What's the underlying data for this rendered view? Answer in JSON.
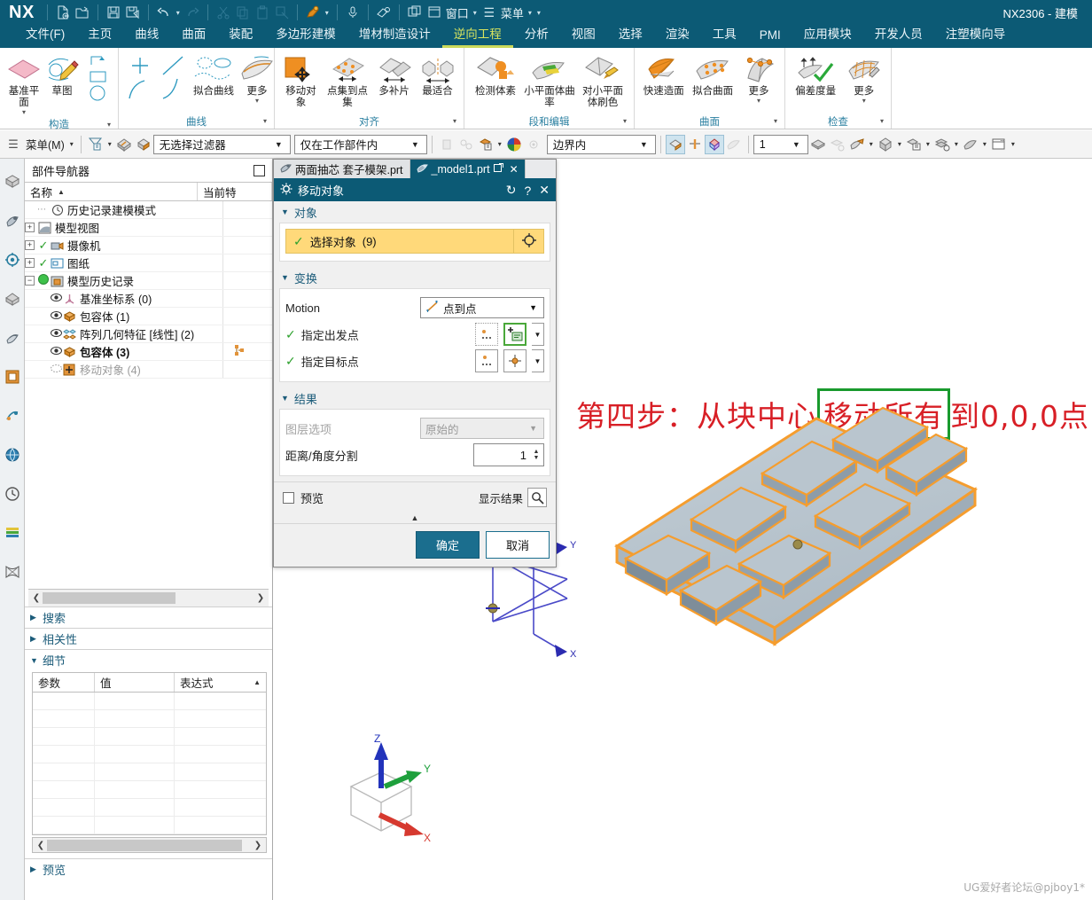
{
  "titlebar": {
    "logo": "NX",
    "window_label": "窗口",
    "menu_label": "菜单",
    "right_title": "NX2306 - 建模",
    "icons": [
      {
        "name": "new-file-icon"
      },
      {
        "name": "open-file-icon"
      },
      {
        "name": "save-icon"
      },
      {
        "name": "save-as-icon"
      },
      {
        "name": "undo-icon"
      },
      {
        "name": "redo-icon"
      },
      {
        "name": "cut-icon"
      },
      {
        "name": "copy-icon"
      },
      {
        "name": "paste-icon"
      },
      {
        "name": "paste-special-icon"
      },
      {
        "name": "pen-icon"
      },
      {
        "name": "microphone-icon"
      },
      {
        "name": "eraser-icon"
      }
    ]
  },
  "tabs": [
    {
      "label": "文件(F)",
      "active": false
    },
    {
      "label": "主页",
      "active": false
    },
    {
      "label": "曲线",
      "active": false
    },
    {
      "label": "曲面",
      "active": false
    },
    {
      "label": "装配",
      "active": false
    },
    {
      "label": "多边形建模",
      "active": false
    },
    {
      "label": "增材制造设计",
      "active": false
    },
    {
      "label": "逆向工程",
      "active": true
    },
    {
      "label": "分析",
      "active": false
    },
    {
      "label": "视图",
      "active": false
    },
    {
      "label": "选择",
      "active": false
    },
    {
      "label": "渲染",
      "active": false
    },
    {
      "label": "工具",
      "active": false
    },
    {
      "label": "PMI",
      "active": false
    },
    {
      "label": "应用模块",
      "active": false
    },
    {
      "label": "开发人员",
      "active": false
    },
    {
      "label": "注塑模向导",
      "active": false
    }
  ],
  "ribbon": {
    "groups": [
      {
        "title": "构造",
        "items": [
          {
            "label": "基准平面",
            "icon": "datum-plane-icon",
            "caret": true
          },
          {
            "label": "草图",
            "icon": "sketch-icon",
            "caret": false
          },
          {
            "label": "",
            "icon": "curve-shapes-icon",
            "caret": false
          }
        ]
      },
      {
        "title": "曲线",
        "items": [
          {
            "label": "",
            "icon": "point-cross-icon",
            "caret": false
          },
          {
            "label": "",
            "icon": "line-icon",
            "caret": false
          },
          {
            "label": "拟合曲线",
            "icon": "fit-curve-icon",
            "caret": false
          },
          {
            "label": "更多",
            "icon": "more-curve-icon",
            "caret": true
          }
        ]
      },
      {
        "title": "对齐",
        "items": [
          {
            "label": "移动对象",
            "icon": "move-object-icon",
            "caret": false
          },
          {
            "label": "点集到点集",
            "icon": "point-set-to-point-set-icon",
            "caret": false
          },
          {
            "label": "多补片",
            "icon": "multi-patch-icon",
            "caret": false
          },
          {
            "label": "最适合",
            "icon": "best-fit-icon",
            "caret": false
          }
        ]
      },
      {
        "title": "段和编辑",
        "items": [
          {
            "label": "检测体素",
            "icon": "detect-primitives-icon",
            "caret": false
          },
          {
            "label": "小平面体曲率",
            "icon": "facet-body-curvature-icon",
            "caret": false
          },
          {
            "label": "对小平面体刷色",
            "icon": "paint-facet-body-icon",
            "caret": false
          }
        ]
      },
      {
        "title": "曲面",
        "items": [
          {
            "label": "快速造面",
            "icon": "rapid-surface-icon",
            "caret": false
          },
          {
            "label": "拟合曲面",
            "icon": "fit-surface-icon",
            "caret": false
          },
          {
            "label": "更多",
            "icon": "more-surface-icon",
            "caret": true
          }
        ]
      },
      {
        "title": "检查",
        "items": [
          {
            "label": "偏差度量",
            "icon": "deviation-gauge-icon",
            "caret": false
          },
          {
            "label": "更多",
            "icon": "more-inspect-icon",
            "caret": true
          }
        ]
      }
    ]
  },
  "seltoolbar": {
    "menu_label": "菜单(M)",
    "filter_value": "无选择过滤器",
    "scope_value": "仅在工作部件内",
    "boundary_value": "边界内",
    "layer_value": "1",
    "icons": [
      {
        "name": "hamburger-icon"
      },
      {
        "name": "selection-filter-icon"
      },
      {
        "name": "shaded-body-icon"
      },
      {
        "name": "face-select-icon"
      },
      {
        "name": "lock-select-icon"
      },
      {
        "name": "snap-point-icon"
      },
      {
        "name": "object-color-icon"
      },
      {
        "name": "color-wheel-icon"
      },
      {
        "name": "settings-gear-icon"
      },
      {
        "name": "shaded-display-icon"
      },
      {
        "name": "section-icon"
      },
      {
        "name": "orient-view-icon"
      },
      {
        "name": "wireframe-icon"
      },
      {
        "name": "layer-visible-icon"
      },
      {
        "name": "layer-settings-icon"
      },
      {
        "name": "move-face-icon"
      },
      {
        "name": "body-icon"
      },
      {
        "name": "assembly-icon"
      },
      {
        "name": "stack-settings-icon"
      },
      {
        "name": "render-style-icon"
      },
      {
        "name": "window-layout-icon"
      }
    ]
  },
  "rail": {
    "icons": [
      "assembly-navigator-icon",
      "part-navigator-icon",
      "reuse-library-icon",
      "hd3d-icon",
      "system-navigator-icon",
      "web-browser-icon",
      "history-icon",
      "process-icon",
      "roles-icon",
      "layers-icon",
      "customer-defaults-icon"
    ]
  },
  "navigator": {
    "title": "部件导航器",
    "columns": [
      {
        "label": "名称",
        "sorted": true
      },
      {
        "label": "当前特"
      }
    ],
    "rows": [
      {
        "expander": "",
        "check": "",
        "eye": "",
        "icon": "clock-icon",
        "label": "历史记录建模模式",
        "style": "normal"
      },
      {
        "expander": "+",
        "check": "",
        "eye": "",
        "icon": "model-views-icon",
        "label": "模型视图",
        "style": "normal"
      },
      {
        "expander": "+",
        "check": "ok",
        "eye": "",
        "icon": "camera-icon",
        "label": "摄像机",
        "style": "normal"
      },
      {
        "expander": "+",
        "check": "ok",
        "eye": "",
        "icon": "drawing-icon",
        "label": "图纸",
        "style": "normal"
      },
      {
        "expander": "-",
        "check": "green-dot",
        "eye": "",
        "icon": "model-history-icon",
        "label": "模型历史记录",
        "style": "normal"
      },
      {
        "expander": "",
        "check": "",
        "eye": "eye",
        "icon": "datum-csys-icon",
        "label": "基准坐标系 (0)",
        "style": "normal"
      },
      {
        "expander": "",
        "check": "",
        "eye": "eye",
        "icon": "bounding-body-icon",
        "label": "包容体 (1)",
        "style": "normal"
      },
      {
        "expander": "",
        "check": "",
        "eye": "eye",
        "icon": "pattern-feature-icon",
        "label": "阵列几何特征 [线性] (2)",
        "style": "normal"
      },
      {
        "expander": "",
        "check": "",
        "eye": "eye",
        "icon": "bounding-body-icon",
        "label": "包容体 (3)",
        "style": "bold",
        "marker": true
      },
      {
        "expander": "",
        "check": "",
        "eye": "dots",
        "icon": "move-object-icon",
        "label": "移动对象 (4)",
        "style": "grey"
      }
    ],
    "sections": [
      {
        "label": "搜索",
        "expanded": false
      },
      {
        "label": "相关性",
        "expanded": false
      },
      {
        "label": "细节",
        "expanded": true
      }
    ],
    "details": {
      "columns": [
        "参数",
        "值",
        "表达式"
      ],
      "rows": [
        [
          "",
          "",
          ""
        ],
        [
          "",
          "",
          ""
        ],
        [
          "",
          "",
          ""
        ],
        [
          "",
          "",
          ""
        ],
        [
          "",
          "",
          ""
        ],
        [
          "",
          "",
          ""
        ],
        [
          "",
          "",
          ""
        ]
      ]
    },
    "preview_label": "预览"
  },
  "dialog": {
    "file_tabs": [
      {
        "label": "两面抽芯 套子模架.prt",
        "active": false,
        "closable": false
      },
      {
        "label": "_model1.prt",
        "active": true,
        "closable": true
      }
    ],
    "title": "移动对象",
    "title_actions": [
      "reset-icon",
      "help-icon",
      "close-icon"
    ],
    "sections": {
      "object": {
        "header": "对象",
        "select_label": "选择对象",
        "select_count": "(9)"
      },
      "transform": {
        "header": "变换",
        "motion_label": "Motion",
        "motion_value": "点到点",
        "start_point_label": "指定出发点",
        "target_point_label": "指定目标点"
      },
      "result": {
        "header": "结果",
        "layer_label": "图层选项",
        "layer_value": "原始的",
        "divide_label": "距离/角度分割",
        "divide_value": "1"
      }
    },
    "preview_label": "预览",
    "show_result_label": "显示结果",
    "ok_label": "确定",
    "cancel_label": "取消"
  },
  "graphics": {
    "annotation": {
      "prefix": "第四步：从块中心 ",
      "boxed": "移动所有",
      "suffix": " 到0,0,0点",
      "text_color": "#d81f26",
      "box_color": "#199a2d"
    },
    "model": {
      "name": "plate-with-pockets",
      "highlight_color": "#f59d2e",
      "face_color": "#b9c6cf",
      "pockets": 8
    },
    "wcs": {
      "x_label": "X",
      "y_label": "Y"
    },
    "triad": {
      "x_label": "X",
      "y_label": "Y",
      "z_label": "Z",
      "x_color": "#d6392f",
      "y_color": "#1ea03c",
      "z_color": "#2233bb"
    },
    "watermark": "UG爱好者论坛@pjboy1*"
  }
}
